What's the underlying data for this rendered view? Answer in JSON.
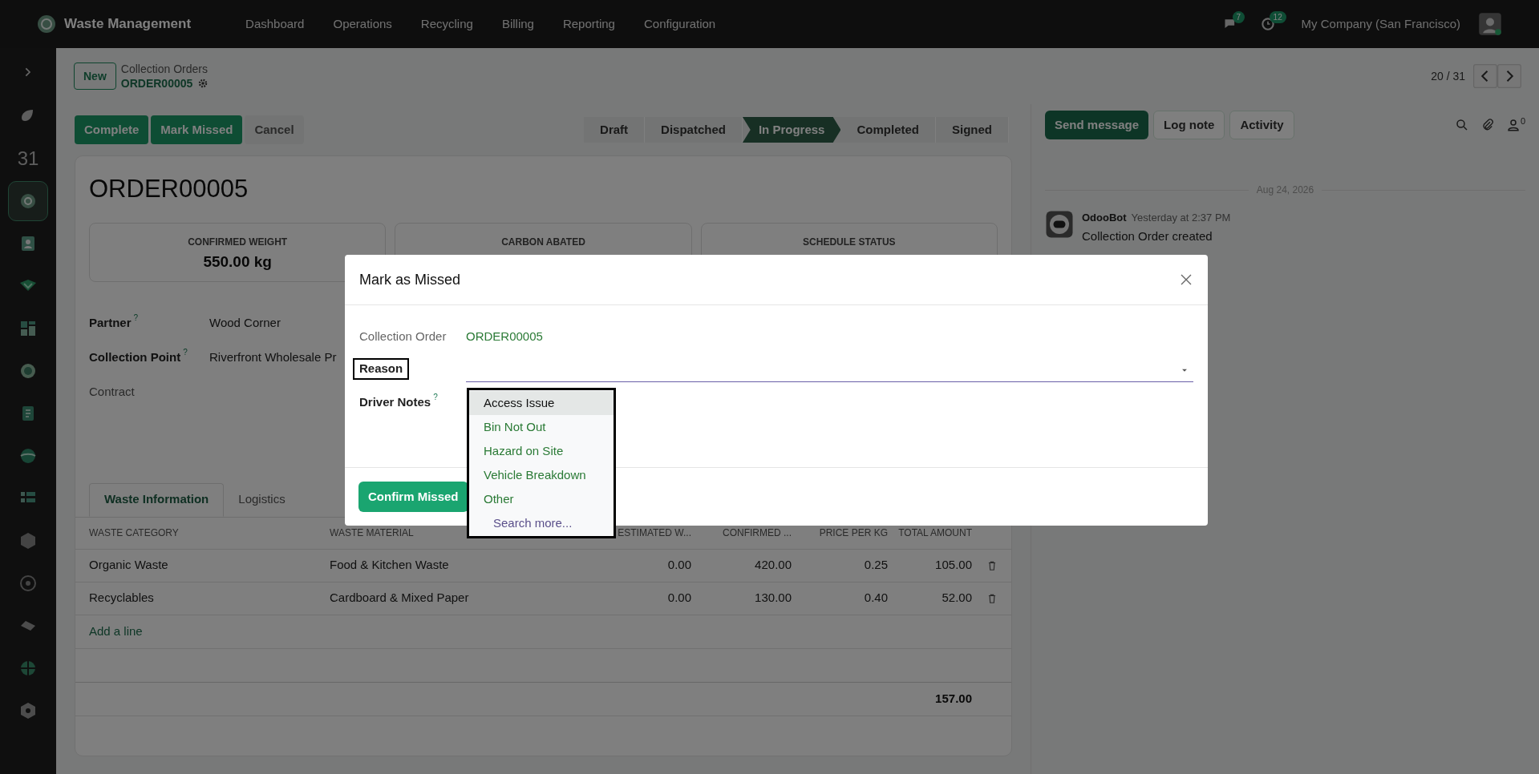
{
  "navbar": {
    "app_name": "Waste Management",
    "menu": [
      "Dashboard",
      "Operations",
      "Recycling",
      "Billing",
      "Reporting",
      "Configuration"
    ],
    "messages_badge": "7",
    "activities_badge": "12",
    "company": "My Company (San Francisco)"
  },
  "sidebar": {
    "items": [
      {
        "selected": false
      },
      {
        "label": "31",
        "selected": false
      },
      {
        "selected": true
      },
      {
        "selected": false
      },
      {
        "selected": false
      },
      {
        "selected": false
      },
      {
        "selected": false
      },
      {
        "selected": false
      },
      {
        "selected": false
      },
      {
        "selected": false
      },
      {
        "selected": false
      },
      {
        "selected": false
      },
      {
        "selected": false
      },
      {
        "selected": false
      },
      {
        "selected": false
      }
    ]
  },
  "control_panel": {
    "new_button": "New",
    "breadcrumb": "Collection Orders",
    "record": "ORDER00005",
    "pager": "20 / 31"
  },
  "actions": [
    {
      "label": "Complete",
      "kind": "primary"
    },
    {
      "label": "Mark Missed",
      "kind": "primary"
    },
    {
      "label": "Cancel",
      "kind": "secondary"
    }
  ],
  "statusbar": [
    {
      "label": "Draft",
      "selected": false
    },
    {
      "label": "Dispatched",
      "selected": false
    },
    {
      "label": "In Progress",
      "selected": true
    },
    {
      "label": "Completed",
      "selected": false
    },
    {
      "label": "Signed",
      "selected": false
    }
  ],
  "form": {
    "title": "ORDER00005",
    "stats": [
      {
        "label": "CONFIRMED WEIGHT",
        "value": "550.00 kg"
      },
      {
        "label": "CARBON ABATED"
      },
      {
        "label": "SCHEDULE STATUS"
      }
    ],
    "fields": [
      {
        "label": "Partner",
        "help": "?",
        "value": "Wood Corner"
      },
      {
        "label": "Collection Point",
        "help": "?",
        "value": "Riverfront Wholesale Pr"
      },
      {
        "label": "Contract"
      }
    ],
    "tabs": [
      {
        "label": "Waste Information",
        "selected": true
      },
      {
        "label": "Logistics",
        "selected": false
      }
    ],
    "table": {
      "columns": [
        "WASTE CATEGORY",
        "WASTE MATERIAL",
        "ESTIMATED W...",
        "CONFIRMED ...",
        "PRICE PER KG",
        "TOTAL AMOUNT"
      ],
      "rows": [
        [
          "Organic Waste",
          "Food & Kitchen Waste",
          "0.00",
          "420.00",
          "0.25",
          "105.00"
        ],
        [
          "Recyclables",
          "Cardboard & Mixed Paper",
          "0.00",
          "130.00",
          "0.40",
          "52.00"
        ]
      ],
      "add_line": "Add a line",
      "total": "157.00"
    }
  },
  "chatter": {
    "buttons": [
      {
        "label": "Send message",
        "kind": "primary"
      },
      {
        "label": "Log note",
        "kind": "secondary"
      },
      {
        "label": "Activity",
        "kind": "secondary"
      }
    ],
    "followers": "0",
    "date": "Aug 24, 2026",
    "messages": [
      {
        "author": "OdooBot",
        "time": "Yesterday at 2:37 PM",
        "body": "Collection Order created"
      }
    ]
  },
  "dialog": {
    "title": "Mark as Missed",
    "fields": [
      {
        "label": "Collection Order",
        "value": "ORDER00005",
        "kind": "link"
      },
      {
        "label": "Reason",
        "kind": "select",
        "focused": true
      },
      {
        "label": "Driver Notes",
        "help": "?",
        "kind": "text"
      }
    ],
    "dropdown": [
      {
        "label": "Access Issue",
        "kind": "option",
        "selected": true
      },
      {
        "label": "Bin Not Out",
        "kind": "option",
        "selected": false
      },
      {
        "label": "Hazard on Site",
        "kind": "option",
        "selected": false
      },
      {
        "label": "Vehicle Breakdown",
        "kind": "option",
        "selected": false
      },
      {
        "label": "Other",
        "kind": "option",
        "selected": false
      },
      {
        "label": "Search more...",
        "kind": "search",
        "selected": false
      }
    ],
    "confirm_button": "Confirm Missed"
  }
}
